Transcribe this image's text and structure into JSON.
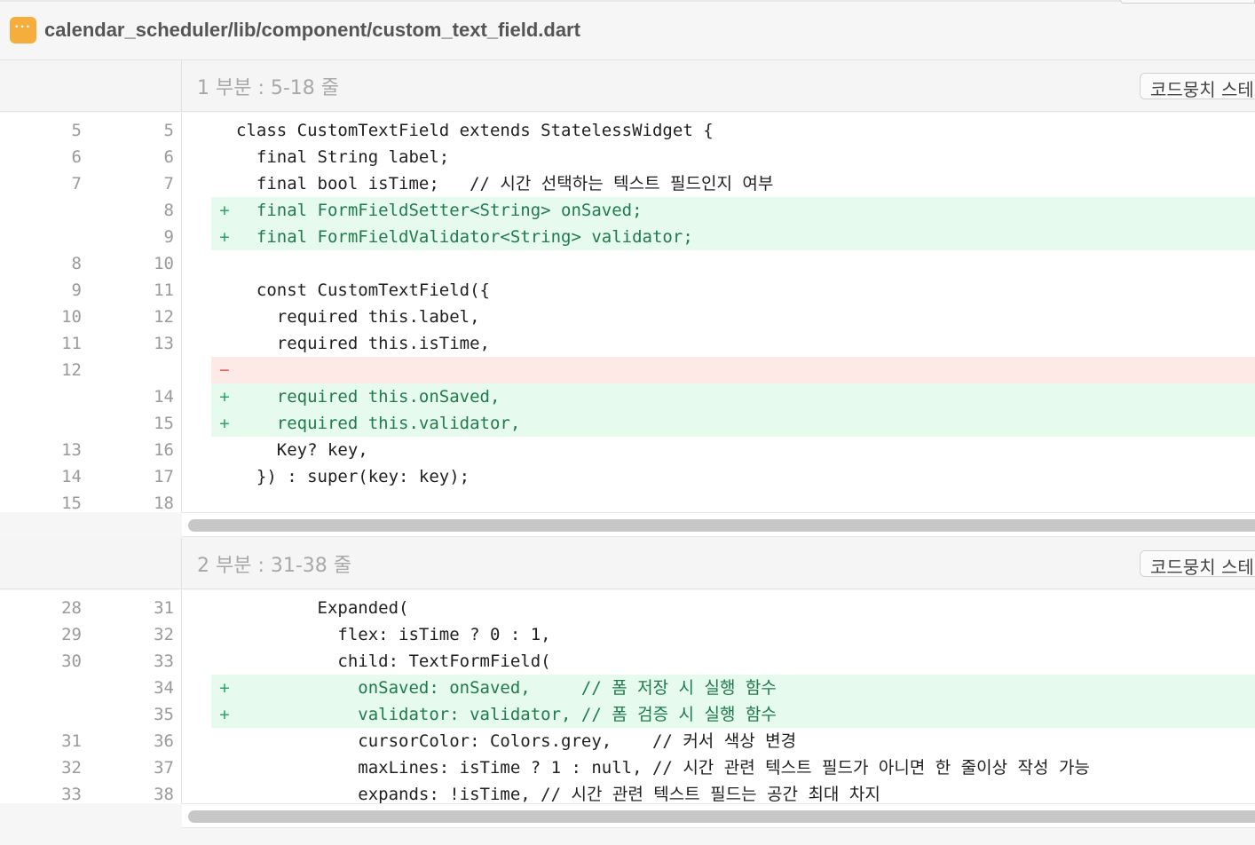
{
  "file_header": {
    "path": "calendar_scheduler/lib/component/custom_text_field.dart",
    "menu_glyph": "···",
    "menu_color": "#f5ad3b"
  },
  "colors": {
    "added_bg": "#e6faee",
    "removed_bg": "#fde9e6",
    "added_text": "#1f7a4c"
  },
  "hunks": [
    {
      "title": "1 부분 : 5-18 줄",
      "button_label": "코드뭉치 스테",
      "lines": [
        {
          "old": "5",
          "new": "5",
          "type": "ctx",
          "mark": "",
          "code": "class CustomTextField extends StatelessWidget {"
        },
        {
          "old": "6",
          "new": "6",
          "type": "ctx",
          "mark": "",
          "code": "  final String label;"
        },
        {
          "old": "7",
          "new": "7",
          "type": "ctx",
          "mark": "",
          "code": "  final bool isTime;   // 시간 선택하는 텍스트 필드인지 여부"
        },
        {
          "old": "",
          "new": "8",
          "type": "add",
          "mark": "+",
          "code": "  final FormFieldSetter<String> onSaved;"
        },
        {
          "old": "",
          "new": "9",
          "type": "add",
          "mark": "+",
          "code": "  final FormFieldValidator<String> validator;"
        },
        {
          "old": "8",
          "new": "10",
          "type": "ctx",
          "mark": "",
          "code": ""
        },
        {
          "old": "9",
          "new": "11",
          "type": "ctx",
          "mark": "",
          "code": "  const CustomTextField({"
        },
        {
          "old": "10",
          "new": "12",
          "type": "ctx",
          "mark": "",
          "code": "    required this.label,"
        },
        {
          "old": "11",
          "new": "13",
          "type": "ctx",
          "mark": "",
          "code": "    required this.isTime,"
        },
        {
          "old": "12",
          "new": "",
          "type": "del",
          "mark": "−",
          "code": ""
        },
        {
          "old": "",
          "new": "14",
          "type": "add",
          "mark": "+",
          "code": "    required this.onSaved,"
        },
        {
          "old": "",
          "new": "15",
          "type": "add",
          "mark": "+",
          "code": "    required this.validator,"
        },
        {
          "old": "13",
          "new": "16",
          "type": "ctx",
          "mark": "",
          "code": "    Key? key,"
        },
        {
          "old": "14",
          "new": "17",
          "type": "ctx",
          "mark": "",
          "code": "  }) : super(key: key);"
        },
        {
          "old": "15",
          "new": "18",
          "type": "ctx",
          "mark": "",
          "code": ""
        }
      ]
    },
    {
      "title": "2 부분 : 31-38 줄",
      "button_label": "코드뭉치 스테",
      "lines": [
        {
          "old": "28",
          "new": "31",
          "type": "ctx",
          "mark": "",
          "code": "        Expanded("
        },
        {
          "old": "29",
          "new": "32",
          "type": "ctx",
          "mark": "",
          "code": "          flex: isTime ? 0 : 1,"
        },
        {
          "old": "30",
          "new": "33",
          "type": "ctx",
          "mark": "",
          "code": "          child: TextFormField("
        },
        {
          "old": "",
          "new": "34",
          "type": "add",
          "mark": "+",
          "code": "            onSaved: onSaved,     // 폼 저장 시 실행 함수"
        },
        {
          "old": "",
          "new": "35",
          "type": "add",
          "mark": "+",
          "code": "            validator: validator, // 폼 검증 시 실행 함수"
        },
        {
          "old": "31",
          "new": "36",
          "type": "ctx",
          "mark": "",
          "code": "            cursorColor: Colors.grey,    // 커서 색상 변경"
        },
        {
          "old": "32",
          "new": "37",
          "type": "ctx",
          "mark": "",
          "code": "            maxLines: isTime ? 1 : null, // 시간 관련 텍스트 필드가 아니면 한 줄이상 작성 가능"
        },
        {
          "old": "33",
          "new": "38",
          "type": "ctx",
          "mark": "",
          "code": "            expands: !isTime, // 시간 관련 텍스트 필드는 공간 최대 차지"
        }
      ]
    }
  ]
}
